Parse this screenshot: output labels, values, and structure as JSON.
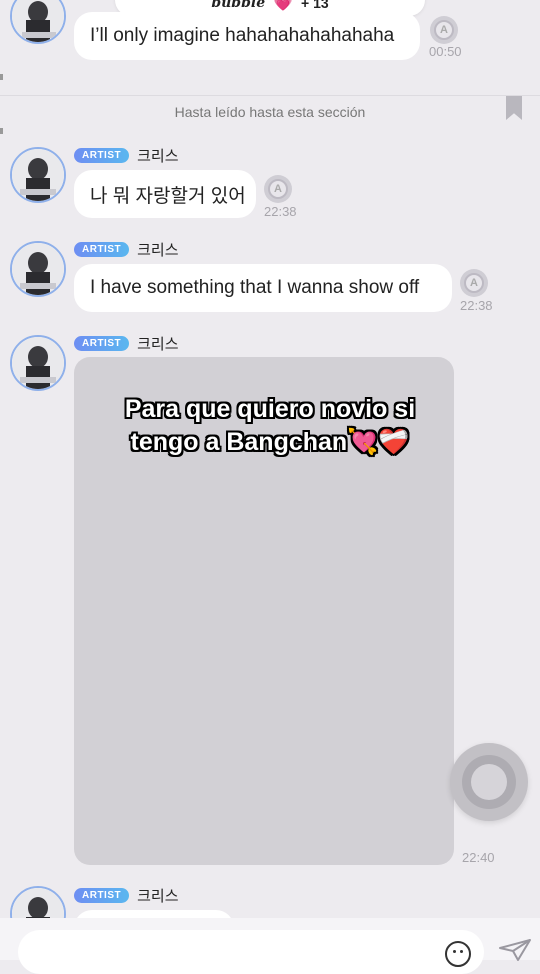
{
  "header": {
    "brand": "bubble",
    "heart": "💗",
    "count": "+ 13"
  },
  "messages": {
    "m0": {
      "text": "I’ll only imagine hahahahahahahaha",
      "time": "00:50"
    },
    "read_marker": "Hasta leído hasta esta sección",
    "m1": {
      "badge": "ARTIST",
      "name": "크리스",
      "text": "나 뭐 자랑할거 있어",
      "time": "22:38"
    },
    "m2": {
      "badge": "ARTIST",
      "name": "크리스",
      "text": "I have something that I wanna show off",
      "time": "22:38"
    },
    "m3": {
      "badge": "ARTIST",
      "name": "크리스",
      "overlay_line1": "Para que quiero novio si",
      "overlay_line2": "tengo a Bangchan💘❤️‍🩹",
      "time": "22:40"
    },
    "m4": {
      "badge": "ARTIST",
      "name": "크리스"
    }
  },
  "icons": {
    "reply": "reply-a-icon",
    "emoji": "emoji-icon",
    "send": "send-plane-icon",
    "bookmark": "bookmark-icon"
  },
  "colors": {
    "background": "#edebef",
    "badge_start": "#6e8ef2",
    "badge_end": "#5ab7ef",
    "avatar_ring": "#8fb0ea"
  }
}
